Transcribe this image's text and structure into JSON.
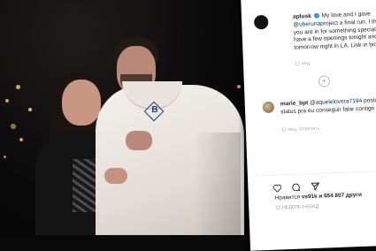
{
  "post": {
    "author": "aplusk",
    "caption_prefix": "My love and I gave",
    "caption_mention": "@uberunaproject",
    "caption_rest": "a final run. I think you are in for something special! We have a few openings tonight and tomorrow night in LA. Link in bio.",
    "caption_time": "12 нед.",
    "comment_user": "marie_bpt",
    "comment_mention": "@aquelelovera7194",
    "comment_text": "posta um status pra eu conseguir falar contigo",
    "comment_meta": "12 нед.  Ответить",
    "likes_prefix": "Нравится",
    "likes_user": "vs91k",
    "likes_suffix": "и 654 807 други",
    "post_date": "12 НЕДЕЛЬ НАЗАД"
  },
  "icons": {
    "like": "heart-icon",
    "comment": "comment-icon",
    "share": "share-icon",
    "more": "more-icon",
    "load_more": "plus-icon"
  },
  "colors": {
    "link": "#00376b",
    "verified": "#3897f0",
    "panel_bg": "#ffffff",
    "photo_bg": "#0a0909"
  }
}
